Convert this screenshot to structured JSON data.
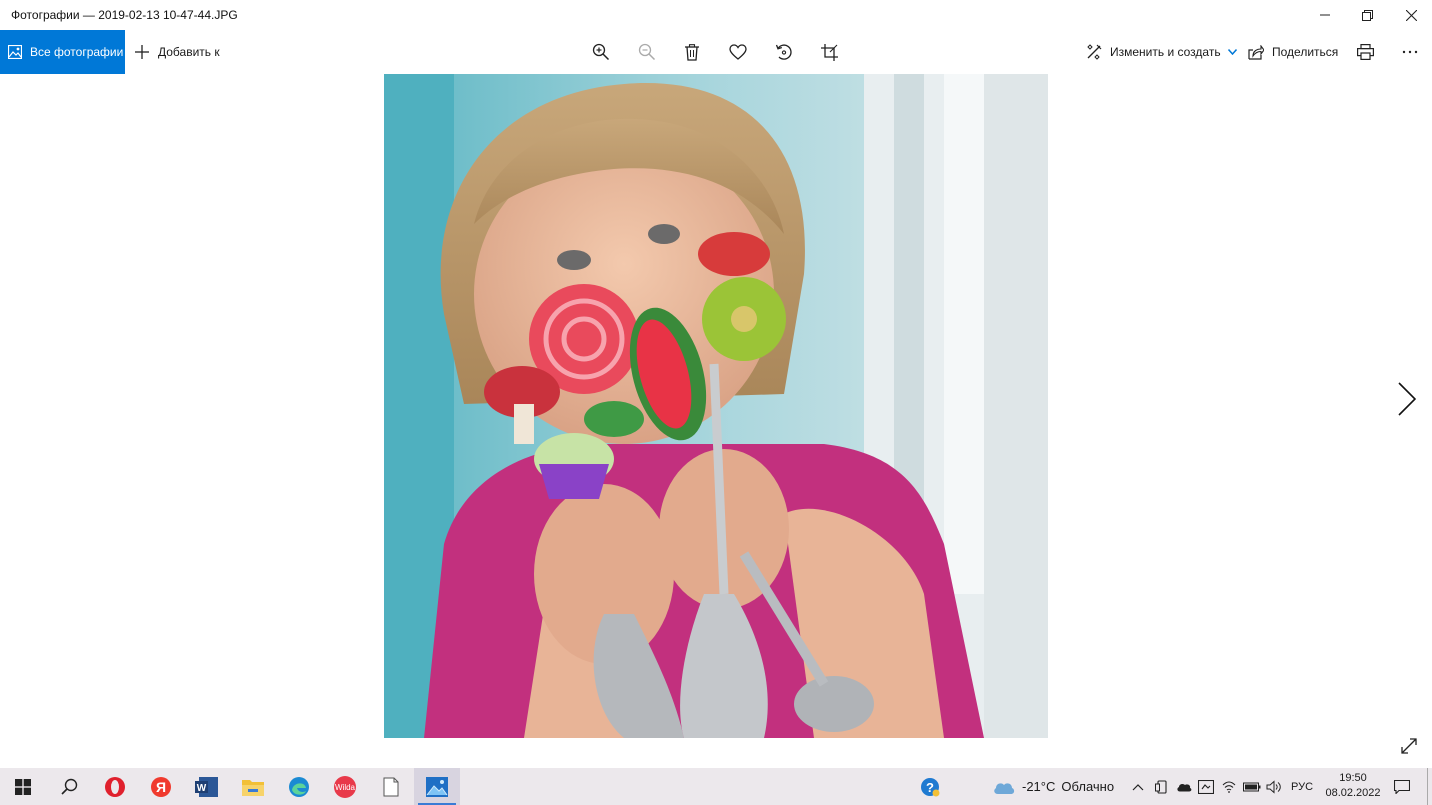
{
  "window": {
    "title": "Фотографии — 2019-02-13 10-47-44.JPG",
    "minimize_icon": "minimize-icon",
    "maximize_icon": "restore-icon",
    "close_icon": "close-icon"
  },
  "toolbar": {
    "all_photos_label": "Все фотографии",
    "add_to_label": "Добавить к",
    "edit_create_label": "Изменить и создать",
    "share_label": "Поделиться",
    "icons": [
      "zoom-in-icon",
      "zoom-out-icon",
      "delete-icon",
      "heart-icon",
      "rotate-icon",
      "crop-icon",
      "print-icon",
      "more-icon"
    ]
  },
  "colors": {
    "accent": "#0078d7",
    "taskbar_bg": "#ece8ec"
  },
  "taskbar": {
    "apps": [
      "start-icon",
      "search-icon",
      "opera-icon",
      "yandex-icon",
      "word-icon",
      "file-explorer-icon",
      "edge-icon",
      "wildberries-icon",
      "document-icon",
      "photos-icon"
    ],
    "yandex_label": "Я",
    "word_label": "W",
    "wild_label": "Wilda",
    "weather_temp": "-21°C",
    "weather_text": "Облачно",
    "lang": "РУС",
    "time": "19:50",
    "date": "08.02.2022"
  }
}
